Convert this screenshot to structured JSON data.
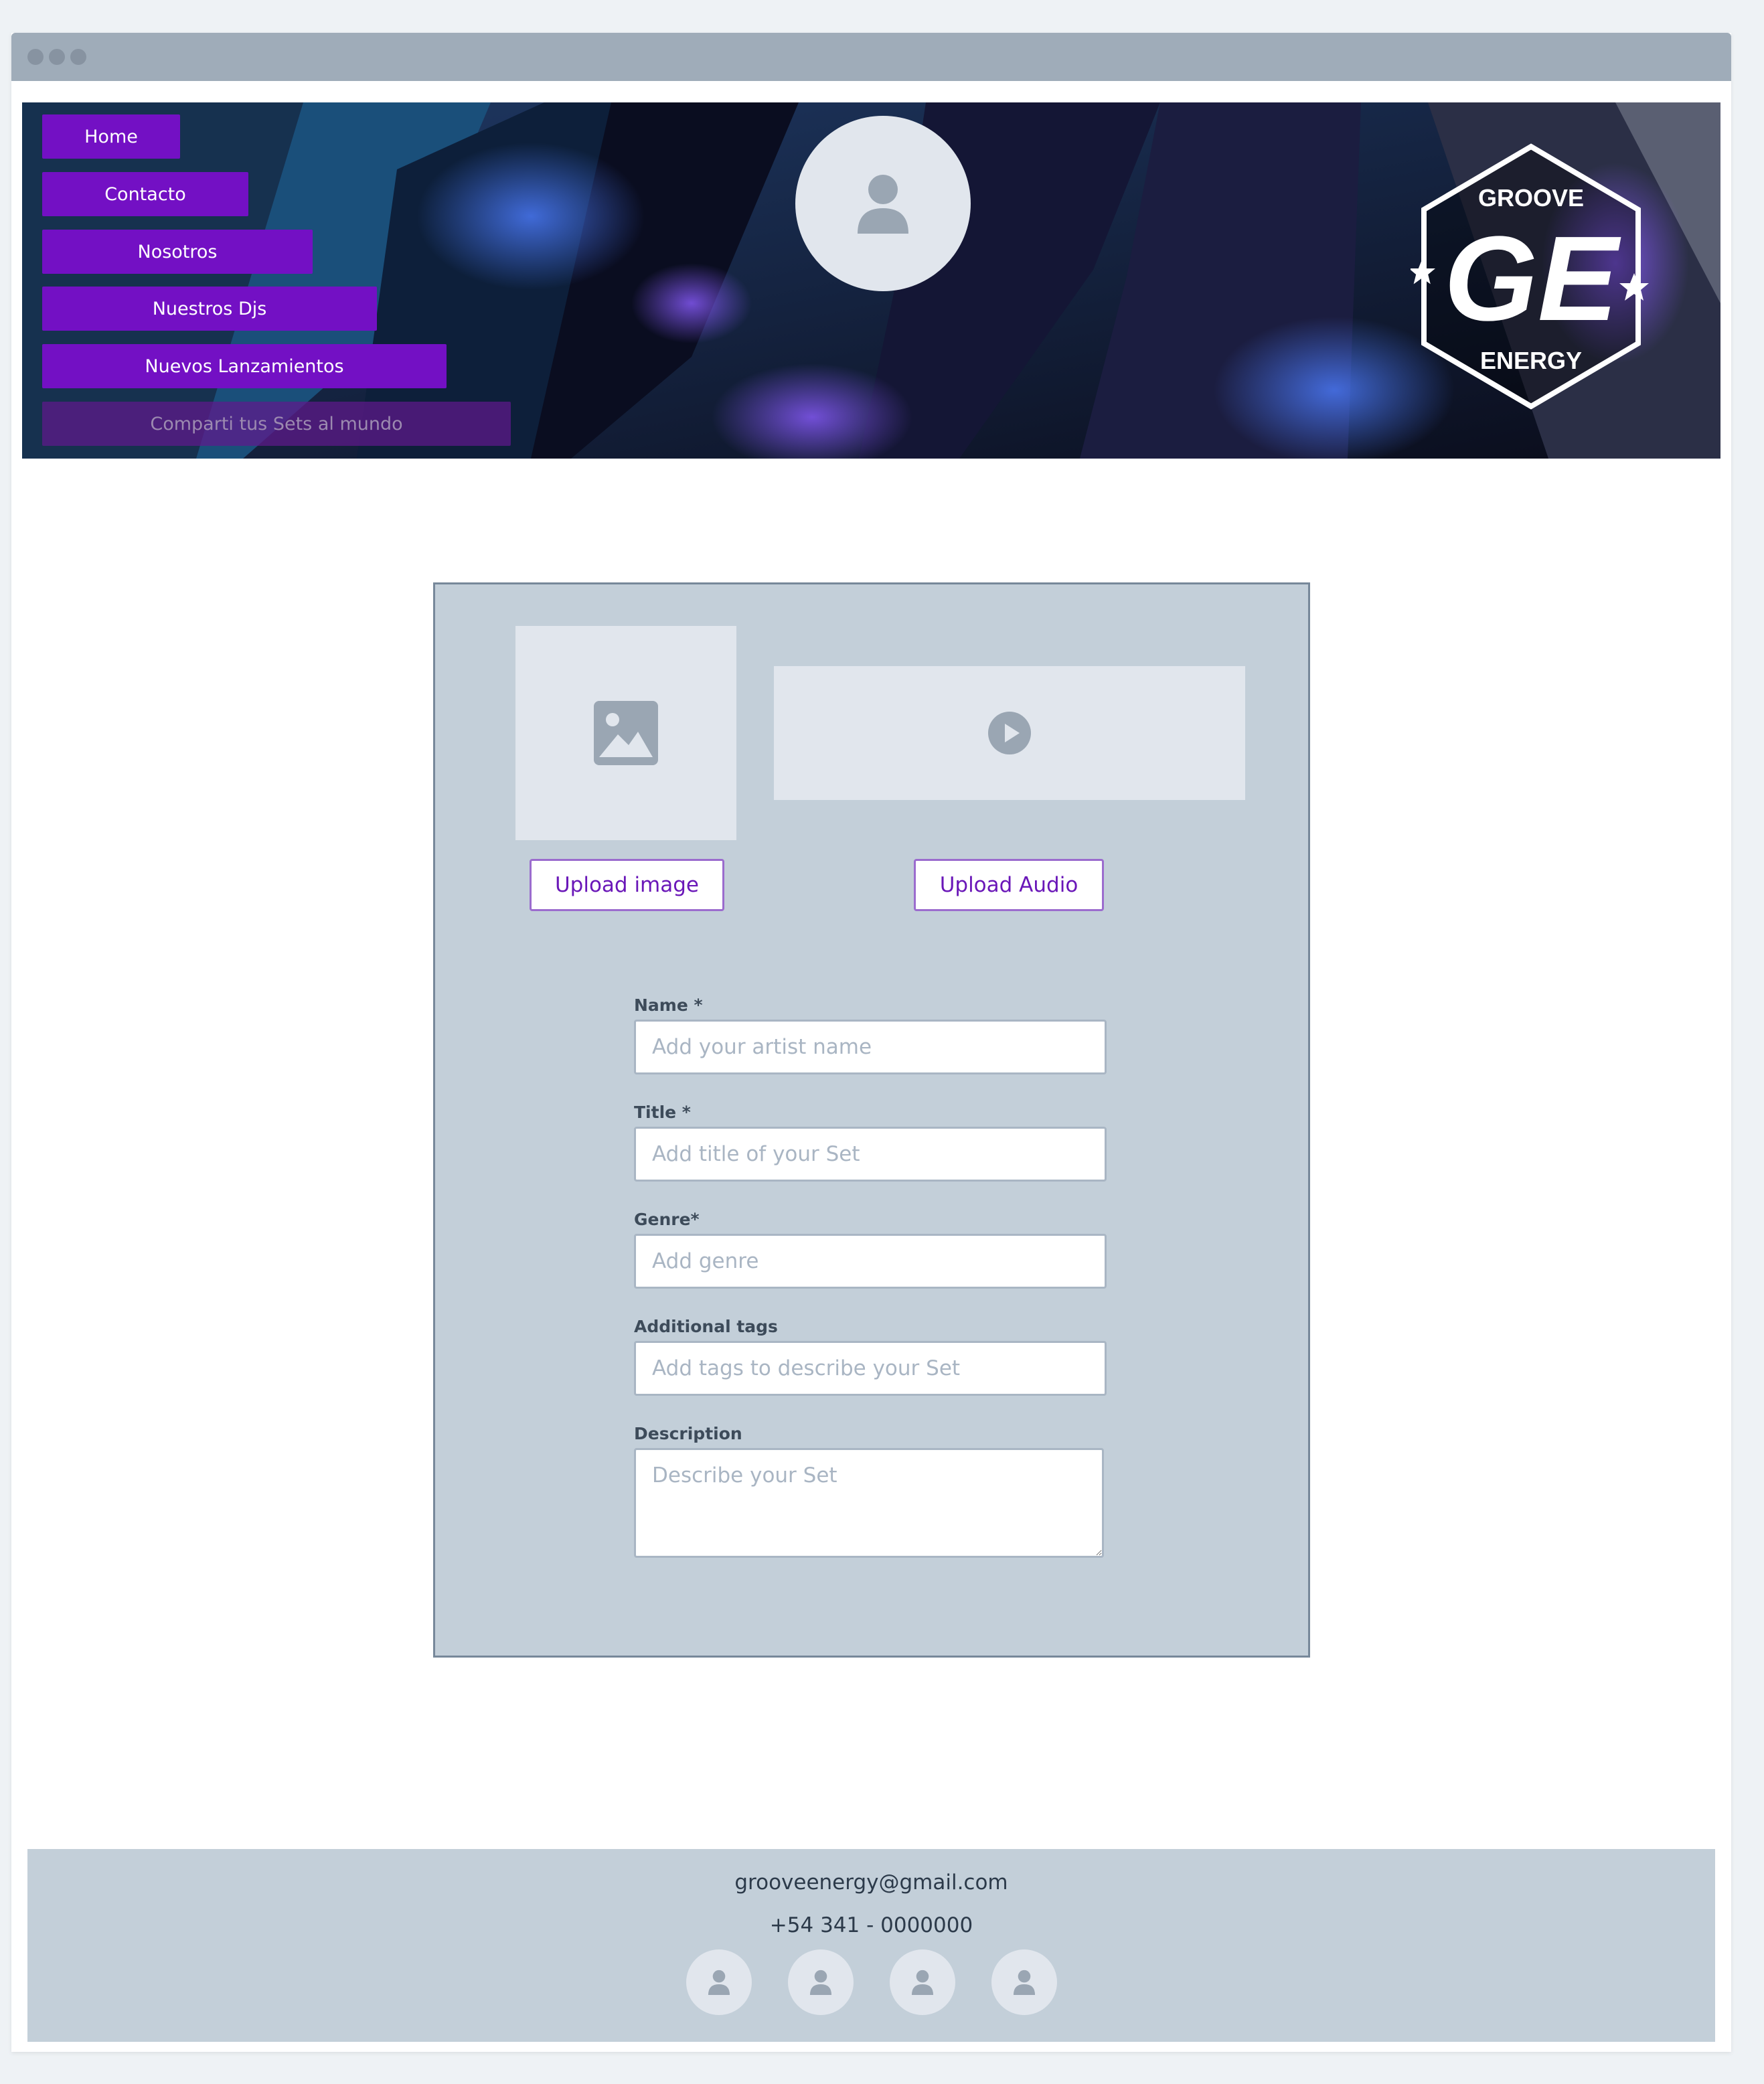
{
  "nav": {
    "items": [
      {
        "label": "Home"
      },
      {
        "label": "Contacto"
      },
      {
        "label": "Nosotros"
      },
      {
        "label": "Nuestros Djs"
      },
      {
        "label": "Nuevos Lanzamientos"
      },
      {
        "label": "Comparti tus Sets al mundo"
      }
    ]
  },
  "logo": {
    "top_text": "GROOVE",
    "monogram": "GE",
    "bottom_text": "ENERGY"
  },
  "upload": {
    "image_button": "Upload image",
    "audio_button": "Upload Audio"
  },
  "form": {
    "name": {
      "label": "Name *",
      "placeholder": "Add your artist name"
    },
    "title": {
      "label": "Title *",
      "placeholder": "Add title of your Set"
    },
    "genre": {
      "label": "Genre*",
      "placeholder": "Add genre"
    },
    "tags": {
      "label": "Additional tags",
      "placeholder": "Add tags to describe your Set"
    },
    "description": {
      "label": "Description",
      "placeholder": "Describe your Set"
    }
  },
  "footer": {
    "email": "grooveenergy@gmail.com",
    "phone": "+54 341 - 0000000",
    "social_icons": [
      "user-icon",
      "user-icon",
      "user-icon",
      "user-icon"
    ]
  },
  "colors": {
    "nav_button": "#7310c4",
    "accent_purple": "#6a17b8",
    "card_bg": "#c3cfd9",
    "titlebar": "#9facb9"
  }
}
